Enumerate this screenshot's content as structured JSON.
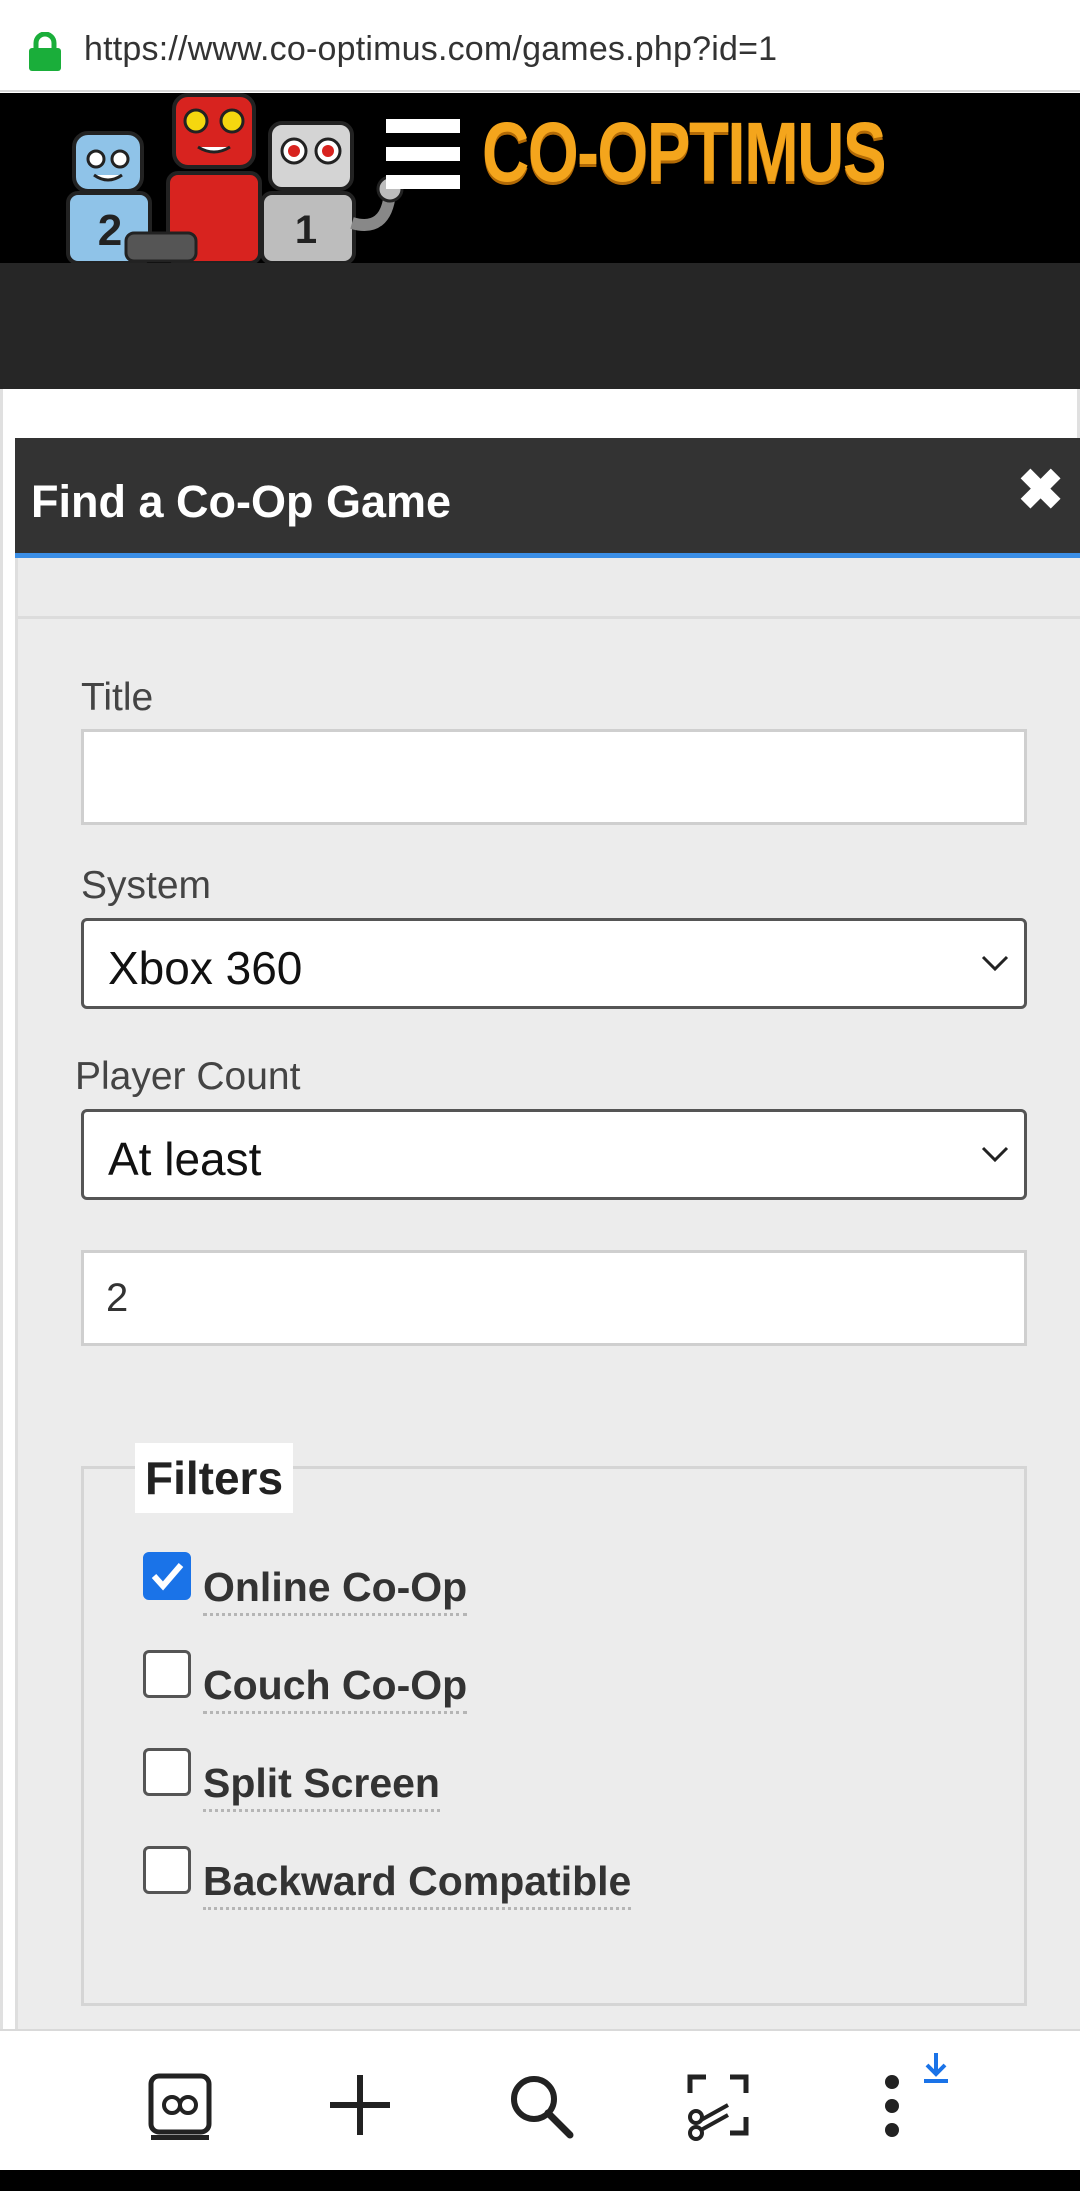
{
  "browser": {
    "url": "https://www.co-optimus.com/games.php?id=1",
    "secure": true
  },
  "site": {
    "logo_text": "CO-OPTIMUS"
  },
  "modal": {
    "title": "Find a Co-Op Game",
    "title_field": {
      "label": "Title",
      "value": ""
    },
    "system_field": {
      "label": "System",
      "selected": "Xbox 360"
    },
    "player_count": {
      "label": "Player Count",
      "comparator_selected": "At least",
      "count_value": "2"
    },
    "filters": {
      "legend": "Filters",
      "items": [
        {
          "label": "Online Co-Op",
          "checked": true
        },
        {
          "label": "Couch Co-Op",
          "checked": false
        },
        {
          "label": "Split Screen",
          "checked": false
        },
        {
          "label": "Backward Compatible",
          "checked": false
        }
      ]
    }
  },
  "toolbar": {
    "icons": [
      "tabs-icon",
      "new-tab-icon",
      "search-icon",
      "screenshot-icon",
      "more-menu-icon"
    ],
    "download_indicator": "download-arrow-icon"
  },
  "colors": {
    "accent_blue": "#3a8ee6",
    "checkbox_blue": "#1a73e8",
    "logo_orange": "#f4a51c",
    "lock_green": "#1aae3a",
    "header_dark": "#333333"
  }
}
